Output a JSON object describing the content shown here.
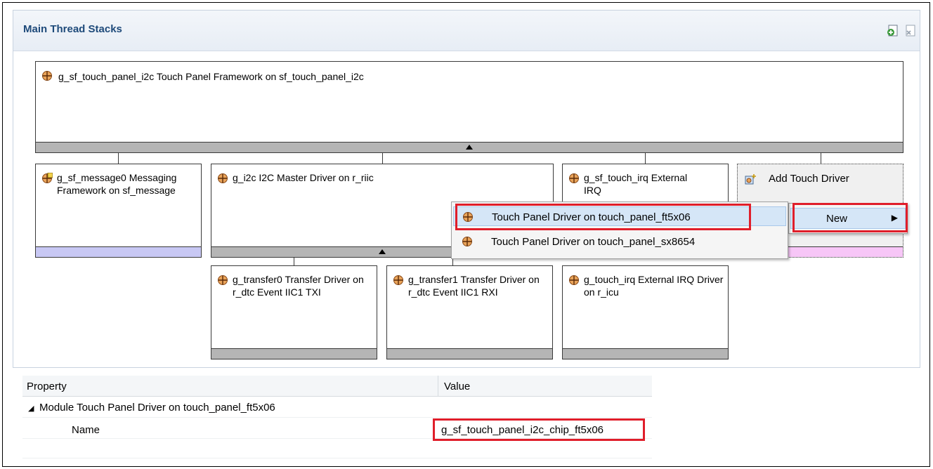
{
  "panel": {
    "title": "Main Thread Stacks"
  },
  "boxes": {
    "top": "g_sf_touch_panel_i2c Touch Panel Framework on sf_touch_panel_i2c",
    "message": "g_sf_message0 Messaging Framework on sf_message",
    "i2c": "g_i2c I2C Master Driver on r_riic",
    "irq": "g_sf_touch_irq External IRQ",
    "add_driver": "Add Touch Driver",
    "transfer0": "g_transfer0 Transfer Driver on r_dtc Event IIC1 TXI",
    "transfer1": "g_transfer1 Transfer Driver on r_dtc Event IIC1 RXI",
    "touch_irq": "g_touch_irq External IRQ Driver on r_icu"
  },
  "context_menu": {
    "new_label": "New",
    "submenu_items": [
      {
        "label": "Touch Panel Driver on touch_panel_ft5x06",
        "icon": "module-icon"
      },
      {
        "label": "Touch Panel Driver on touch_panel_sx8654",
        "icon": "module-icon"
      }
    ]
  },
  "properties": {
    "col_property": "Property",
    "col_value": "Value",
    "group": "Module Touch Panel Driver on touch_panel_ft5x06",
    "rows": [
      {
        "name": "Name",
        "value": "g_sf_touch_panel_i2c_chip_ft5x06"
      }
    ]
  },
  "colors": {
    "title": "#1e4a7a",
    "highlight_red": "#e01e2a",
    "message_bar": "#c8c8f4",
    "add_bar": "#f7c6f7"
  }
}
